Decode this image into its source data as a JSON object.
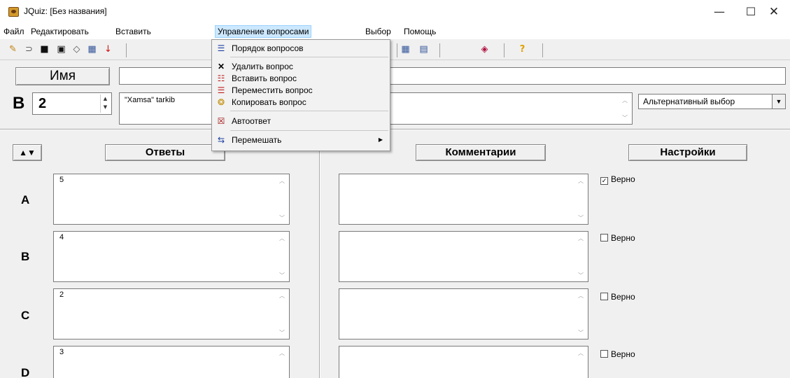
{
  "window": {
    "title": "JQuiz: [Без названия]",
    "minimize": "—",
    "maximize": "☐",
    "close": "✕"
  },
  "menu": [
    "Файл",
    "Редактировать",
    "Вставить",
    "Управление вопросами",
    "Выбор",
    "Помощь"
  ],
  "toolbar": [
    "new-file-icon",
    "open-folder-icon",
    "save-icon",
    "save-as-icon",
    "eraser-icon",
    "web-export-icon",
    "down-arrow-icon",
    "web-icon-2",
    "web-icon-3",
    "config-icon",
    "help-icon"
  ],
  "top": {
    "name_button": "Имя",
    "name_value": "",
    "question_label": "В",
    "question_number": "2",
    "question_text": "\"Xamsa\" tarkib",
    "question_type": "Альтернативный выбор"
  },
  "headers": {
    "reorder": "▲▼",
    "answers": "Ответы",
    "comments": "Комментарии",
    "settings": "Настройки"
  },
  "answers": [
    {
      "letter": "A",
      "text": "5",
      "comment": "",
      "correct_label": "Верно",
      "checked": true
    },
    {
      "letter": "B",
      "text": "4",
      "comment": "",
      "correct_label": "Верно",
      "checked": false
    },
    {
      "letter": "C",
      "text": "2",
      "comment": "",
      "correct_label": "Верно",
      "checked": false
    },
    {
      "letter": "D",
      "text": "3",
      "comment": "",
      "correct_label": "Верно",
      "checked": false
    }
  ],
  "dropdown": [
    {
      "icon": "list-order-icon",
      "label": "Порядок вопросов"
    },
    {
      "icon": "delete-x-icon",
      "label": "Удалить вопрос"
    },
    {
      "icon": "insert-question-icon",
      "label": "Вставить вопрос"
    },
    {
      "icon": "move-question-icon",
      "label": "Переместить вопрос"
    },
    {
      "icon": "copy-question-icon",
      "label": "Копировать вопрос"
    },
    {
      "icon": "auto-answer-icon",
      "label": "Автоответ"
    },
    {
      "icon": "shuffle-icon",
      "label": "Перемешать"
    }
  ],
  "colors": {
    "menu_highlight": "#cce8ff",
    "menu_highlight_border": "#99d1ff"
  }
}
